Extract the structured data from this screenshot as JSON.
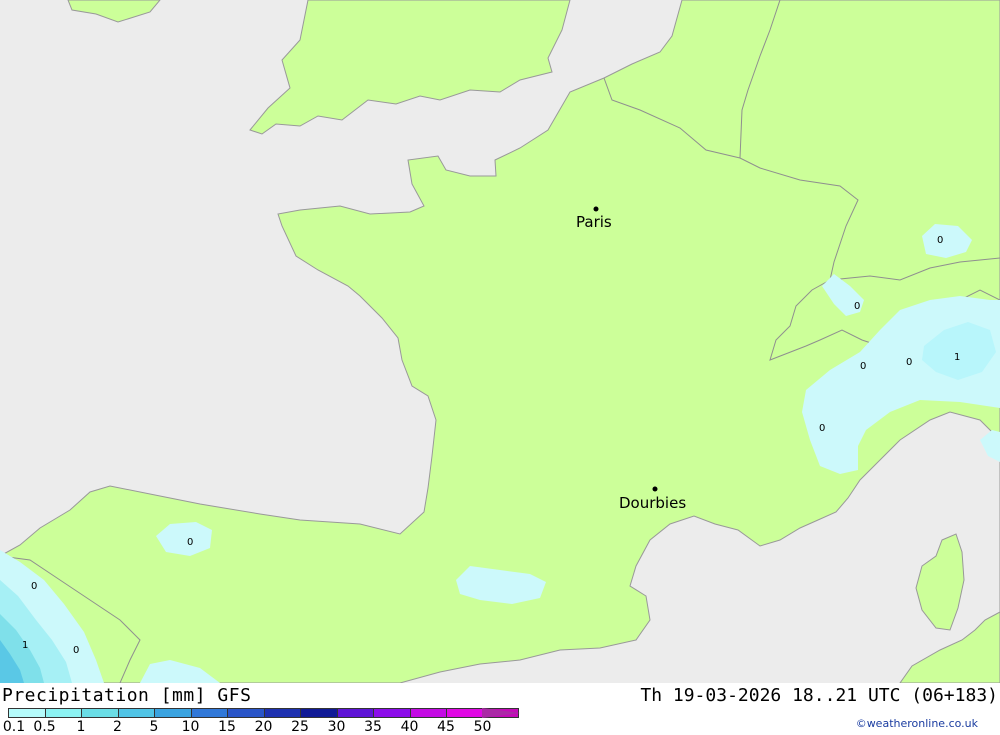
{
  "map": {
    "cities": [
      {
        "name": "Paris"
      },
      {
        "name": "Dourbies"
      }
    ],
    "contour_labels": [
      "0",
      "0",
      "0",
      "0",
      "1",
      "0",
      "0",
      "0",
      "0",
      "1",
      "0"
    ],
    "colors": {
      "sea": "#ececec",
      "land": "#ccff99",
      "border": "#888888",
      "precip_0_1": "#ccf9fb",
      "precip_0_5": "#a6f0f5",
      "precip_1": "#7fe0ea",
      "precip_2": "#5ac8e6"
    }
  },
  "footer": {
    "title": "Precipitation [mm] GFS",
    "datetime": "Th 19-03-2026 18..21 UTC (06+183)",
    "credit": "©weatheronline.co.uk"
  },
  "legend": {
    "colors": [
      "#b5fbfb",
      "#8cf2f2",
      "#6adde6",
      "#50c4e6",
      "#3aa3e0",
      "#3178d8",
      "#2a55c8",
      "#1e31b0",
      "#101a96",
      "#5e14d6",
      "#8c0cea",
      "#c40ae4",
      "#e008e4",
      "#c40ab8"
    ],
    "arrow_color": "#aa2aa6",
    "ticks": [
      "0.1",
      "0.5",
      "1",
      "2",
      "5",
      "10",
      "15",
      "20",
      "25",
      "30",
      "35",
      "40",
      "45",
      "50"
    ]
  }
}
